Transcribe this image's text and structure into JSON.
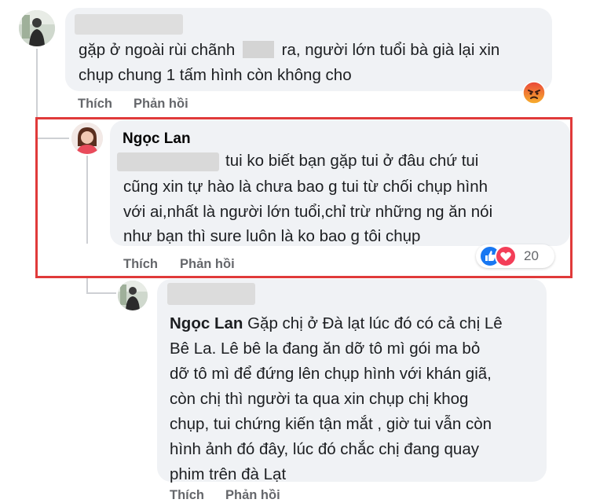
{
  "comment1": {
    "text_before_blur": "gặp ở ngoài rùi chãnh",
    "text_after_blur": "ra, người lớn tuổi bà già lại xin",
    "line2": "chụp chung 1 tấm hình còn không cho",
    "like_label": "Thích",
    "reply_label": "Phản hồi",
    "reaction_icon": "angry-face-icon"
  },
  "comment2": {
    "author": "Ngọc Lan",
    "line1": "tui ko biết bạn gặp tui ở đâu chứ tui",
    "line2": "cũng xin tự hào là chưa bao g tui từ chối chụp hình",
    "line3": "với ai,nhất là người lớn tuổi,chỉ trừ những ng ăn nói",
    "line4": "như bạn thì sure luôn là ko bao g tôi chụp",
    "like_label": "Thích",
    "reply_label": "Phản hồi",
    "reaction_count": "20",
    "reaction_icons": [
      "like-icon",
      "love-icon"
    ],
    "highlight_color": "#e03a3a"
  },
  "comment3": {
    "line1_name": "Ngọc Lan",
    "line1_rest": "Gặp chị ở Đà lạt lúc đó có cả chị Lê",
    "line2": "Bê La. Lê bê la đang ăn dỡ tô mì gói ma bỏ",
    "line3": "dỡ tô mì để đứng lên chụp hình với khán giã,",
    "line4": "còn chị thì người ta qua xin chụp chị khog",
    "line5": "chụp, tui chứng kiến tận mắt , giờ tui vẫn còn",
    "line6": "hình ảnh đó đây, lúc đó chắc chị đang quay",
    "line7": "phim trên đà Lạt",
    "like_label": "Thích",
    "reply_label": "Phản hồi"
  },
  "colors": {
    "bubble": "#f0f2f5",
    "action_text": "#65676b",
    "like_blue": "#1877f2",
    "love_red": "#f33e58",
    "angry_orange": "#f7714c"
  }
}
